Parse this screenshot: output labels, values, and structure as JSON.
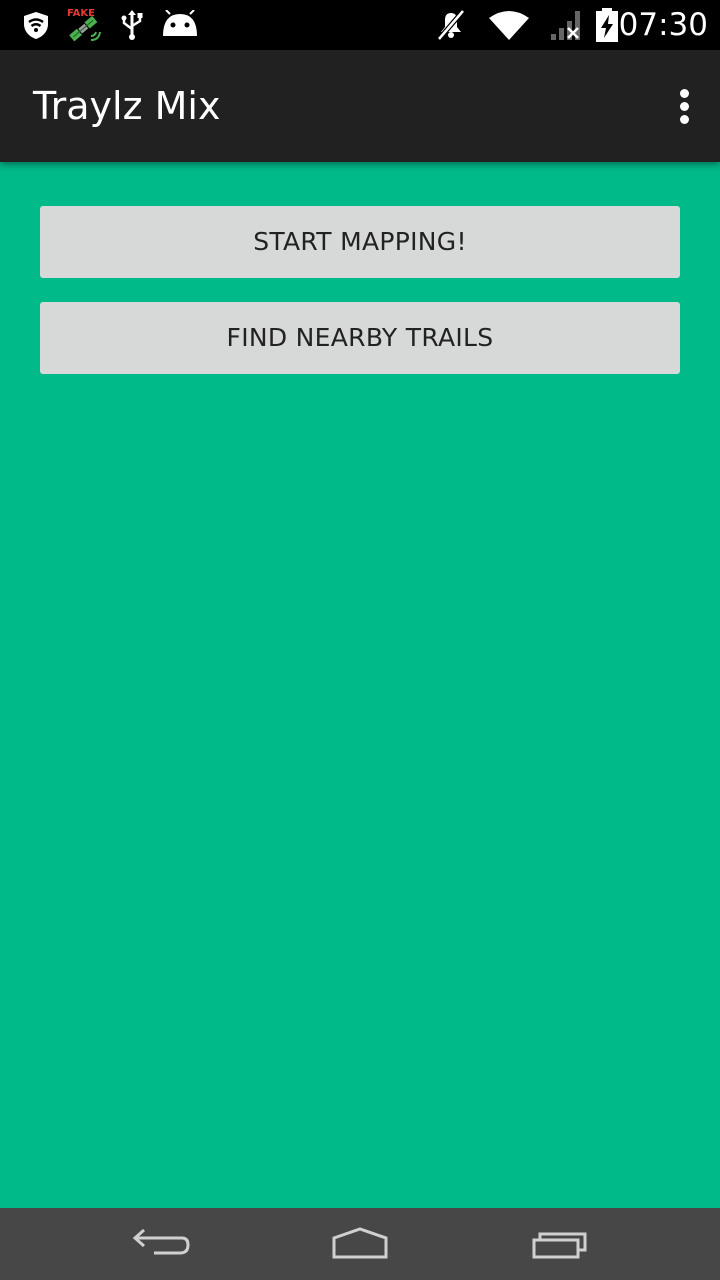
{
  "status_bar": {
    "time": "07:30",
    "icons": [
      "shield-wifi-icon",
      "fake-gps-satellite-icon",
      "usb-icon",
      "android-icon",
      "mute-icon",
      "wifi-icon",
      "no-signal-icon",
      "battery-charging-icon"
    ],
    "fake_label": "FAKE"
  },
  "action_bar": {
    "title": "Traylz Mix",
    "overflow_icon": "more-vert-icon"
  },
  "main": {
    "buttons": [
      {
        "label": "START MAPPING!"
      },
      {
        "label": "FIND NEARBY TRAILS"
      }
    ]
  },
  "nav_bar": {
    "icons": [
      "back-icon",
      "home-icon",
      "recents-icon"
    ]
  },
  "colors": {
    "background": "#00BA89",
    "action_bar": "#212121",
    "button": "#D7D9D8",
    "nav_bar": "#474747"
  }
}
